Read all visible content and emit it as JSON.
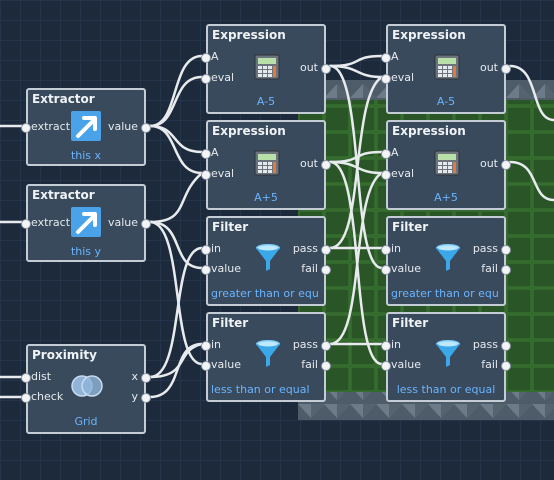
{
  "nodes": {
    "extractor_x": {
      "title": "Extractor",
      "in_label": "extract",
      "out_label": "value",
      "subtitle": "this x"
    },
    "extractor_y": {
      "title": "Extractor",
      "in_label": "extract",
      "out_label": "value",
      "subtitle": "this y"
    },
    "proximity": {
      "title": "Proximity",
      "in1": "dist",
      "in2": "check",
      "out1": "x",
      "out2": "y",
      "subtitle": "Grid"
    },
    "expr_1": {
      "title": "Expression",
      "in1": "A",
      "in2": "eval",
      "out_label": "out",
      "subtitle": "A-5"
    },
    "expr_2": {
      "title": "Expression",
      "in1": "A",
      "in2": "eval",
      "out_label": "out",
      "subtitle": "A+5"
    },
    "expr_3": {
      "title": "Expression",
      "in1": "A",
      "in2": "eval",
      "out_label": "out",
      "subtitle": "A-5"
    },
    "expr_4": {
      "title": "Expression",
      "in1": "A",
      "in2": "eval",
      "out_label": "out",
      "subtitle": "A+5"
    },
    "filter_1": {
      "title": "Filter",
      "in1": "in",
      "in2": "value",
      "out1": "pass",
      "out2": "fail",
      "subtitle": "greater than or equ"
    },
    "filter_2": {
      "title": "Filter",
      "in1": "in",
      "in2": "value",
      "out1": "pass",
      "out2": "fail",
      "subtitle": "less than or equal"
    },
    "filter_3": {
      "title": "Filter",
      "in1": "in",
      "in2": "value",
      "out1": "pass",
      "out2": "fail",
      "subtitle": "greater than or equ"
    },
    "filter_4": {
      "title": "Filter",
      "in1": "in",
      "in2": "value",
      "out1": "pass",
      "out2": "fail",
      "subtitle": "less than or equal"
    }
  },
  "icons": {
    "extractor": "extract-arrow-icon",
    "expression": "calculator-icon",
    "filter": "funnel-icon",
    "proximity": "venn-circles-icon"
  },
  "colors": {
    "canvas_bg": "#1d2a3b",
    "node_bg": "#3a4a5d",
    "node_border": "#c4ccd6",
    "subtitle": "#69b4ff",
    "wire": "#e8ebee",
    "field_green": "#2f5f2a",
    "field_border": "#5c6a78"
  }
}
